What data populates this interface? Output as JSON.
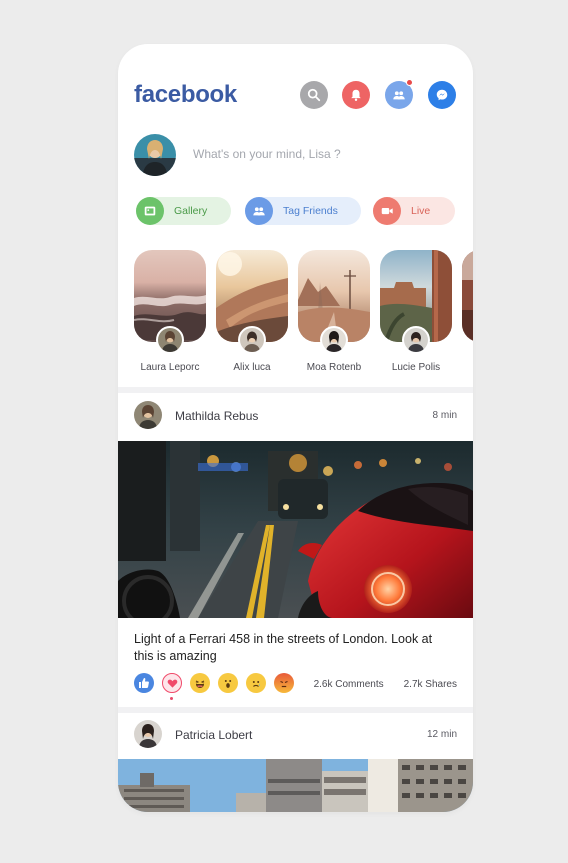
{
  "header": {
    "logo": "facebook",
    "icons": [
      "search-icon",
      "bell-icon",
      "friends-icon",
      "messenger-icon"
    ],
    "colors": {
      "brand": "#3b5ba3",
      "search": "#a8a8ab",
      "bell": "#ee6464",
      "friends": "#7aa6ea",
      "messenger": "#2d7fe7"
    }
  },
  "composer": {
    "placeholder": "What's on your mind, Lisa ?"
  },
  "actions": [
    {
      "label": "Gallery",
      "icon": "gallery-icon",
      "color": "#6cc36a"
    },
    {
      "label": "Tag Friends",
      "icon": "tag-friends-icon",
      "color": "#6b9be6"
    },
    {
      "label": "Live",
      "icon": "video-camera-icon",
      "color": "#ee7b70"
    }
  ],
  "stories": [
    {
      "name": "Laura Leporc"
    },
    {
      "name": "Alix luca"
    },
    {
      "name": "Moa Rotenb"
    },
    {
      "name": "Lucie Polis"
    }
  ],
  "posts": [
    {
      "author": "Mathilda Rebus",
      "time": "8 min",
      "caption": "Light of a Ferrari 458 in the streets of London. Look at this is amazing",
      "comments": "2.6k Comments",
      "shares": "2.7k Shares",
      "reactions": [
        "like-icon",
        "love-icon",
        "haha-icon",
        "wow-icon",
        "sad-icon",
        "angry-icon"
      ],
      "selected_reaction": "love-icon"
    },
    {
      "author": "Patricia Lobert",
      "time": "12 min"
    }
  ]
}
